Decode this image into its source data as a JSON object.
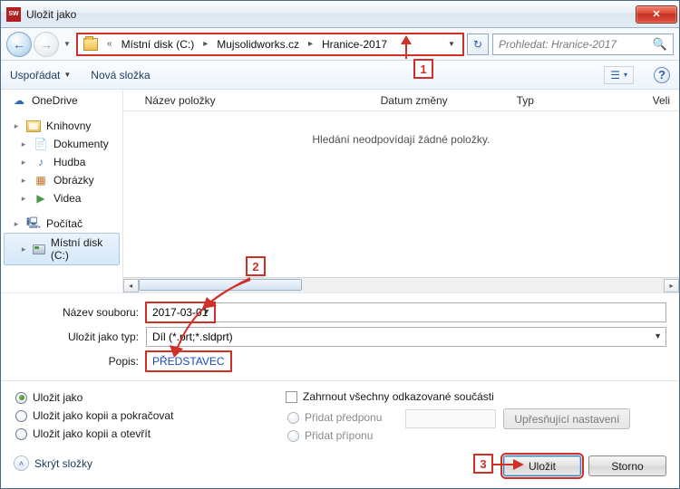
{
  "title": "Uložit jako",
  "nav": {
    "path_segments": [
      "Místní disk (C:)",
      "Mujsolidworks.cz",
      "Hranice-2017"
    ],
    "search_placeholder": "Prohledat: Hranice-2017"
  },
  "toolbar": {
    "organize": "Uspořádat",
    "new_folder": "Nová složka"
  },
  "tree": {
    "onedrive": "OneDrive",
    "libraries": "Knihovny",
    "documents": "Dokumenty",
    "music": "Hudba",
    "pictures": "Obrázky",
    "videos": "Videa",
    "computer": "Počítač",
    "local_disk": "Místní disk (C:)"
  },
  "list": {
    "col_name": "Název položky",
    "col_date": "Datum změny",
    "col_type": "Typ",
    "col_size": "Veli",
    "empty": "Hledání neodpovídají žádné položky."
  },
  "form": {
    "filename_label": "Název souboru:",
    "filename_value": "2017-03-01",
    "type_label": "Uložit jako typ:",
    "type_value": "Díl (*.prt;*.sldprt)",
    "desc_label": "Popis:",
    "desc_value": "PŘEDSTAVEC"
  },
  "options": {
    "save_as": "Uložit jako",
    "save_copy_continue": "Uložit jako kopii a pokračovat",
    "save_copy_open": "Uložit jako kopii a otevřít",
    "include_refs": "Zahrnout všechny odkazované součásti",
    "add_prefix": "Přidat předponu",
    "add_suffix": "Přidat příponu",
    "advanced": "Upřesňující nastavení"
  },
  "footer": {
    "hide_folders": "Skrýt složky",
    "save": "Uložit",
    "cancel": "Storno"
  },
  "callouts": {
    "one": "1",
    "two": "2",
    "three": "3"
  }
}
